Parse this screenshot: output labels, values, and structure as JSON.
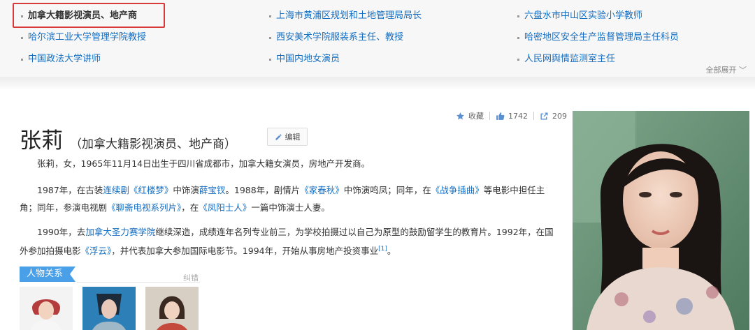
{
  "disambiguation": {
    "items": [
      {
        "label": "加拿大籍影视演员、地产商",
        "active": true
      },
      {
        "label": "上海市黄浦区规划和土地管理局局长"
      },
      {
        "label": "六盘水市中山区实验小学教师"
      },
      {
        "label": "哈尔滨工业大学管理学院教授"
      },
      {
        "label": "西安美术学院服装系主任、教授"
      },
      {
        "label": "哈密地区安全生产监督管理局主任科员"
      },
      {
        "label": "中国政法大学讲师"
      },
      {
        "label": "中国内地女演员"
      },
      {
        "label": "人民网舆情监测室主任"
      }
    ],
    "expand_label": "全部展开"
  },
  "stats": {
    "favorite_label": "收藏",
    "likes": "1742",
    "shares": "209"
  },
  "title": {
    "name": "张莉",
    "subtitle": "（加拿大籍影视演员、地产商）",
    "edit_label": "编辑"
  },
  "summary": "张莉，女，1965年11月14日出生于四川省成都市，加拿大籍女演员，房地产开发商。",
  "para2": {
    "t1": "1987年，在古装",
    "l1": "连续剧",
    "l2": "《红楼梦》",
    "t2": "中饰演",
    "l3": "薛宝钗",
    "t3": "。1988年，剧情片",
    "l4": "《家春秋》",
    "t4": "中饰演鸣凤；同年，在",
    "l5": "《战争插曲》",
    "t5": "等电影中担任主角；同年，参演电视剧",
    "l6": "《聊斋电视系列片》",
    "t6": "，在",
    "l7": "《凤阳士人》",
    "t7": "一篇中饰演士人妻。"
  },
  "para3": {
    "t1": "1990年，去",
    "l1": "加拿大圣力赛学院",
    "t2": "继续深造，成绩连年名列专业前三，为学校拍摄过以自己为原型的鼓励留学生的教育片。1992年，在国外参加拍摄电影",
    "l2": "《浮云》",
    "t3": "，并代表加拿大参加国际电影节。1994年，开始从事房地产投资事业",
    "ref": "[1]",
    "t4": "。"
  },
  "relations": {
    "label": "人物关系",
    "correction_label": "纠错"
  },
  "colors": {
    "link": "#136ec2",
    "highlight": "#d83a3a",
    "relation_tag": "#4aa0e8"
  }
}
